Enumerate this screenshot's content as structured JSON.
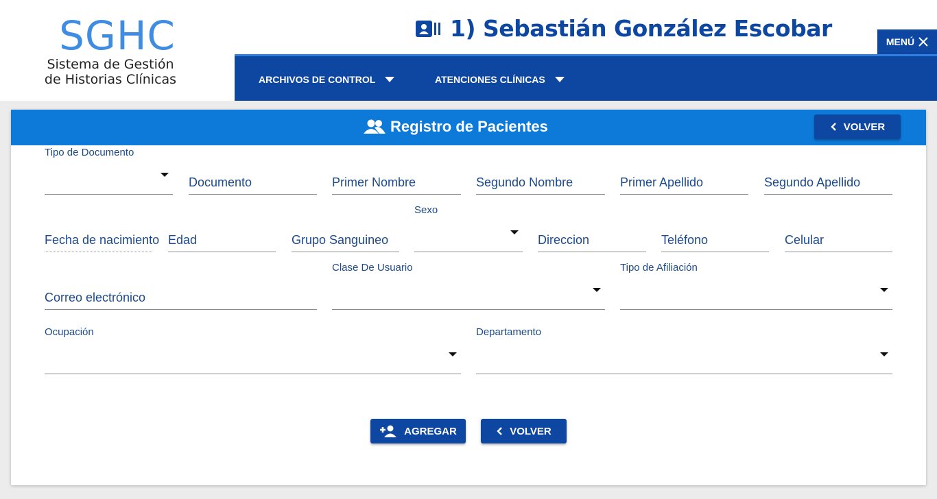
{
  "logo": {
    "title": "SGHC",
    "subtitle_line1": "Sistema de Gestión",
    "subtitle_line2": "de Historias Clínicas"
  },
  "header": {
    "user_title": "1) Sebastián González Escobar",
    "menu_label": "MENÚ"
  },
  "nav": {
    "items": [
      {
        "label": "ARCHIVOS DE CONTROL"
      },
      {
        "label": "ATENCIONES CLÍNICAS"
      }
    ]
  },
  "card": {
    "title": "Registro de Pacientes",
    "back_label": "VOLVER"
  },
  "form": {
    "tipo_documento": "Tipo de Documento",
    "documento": "Documento",
    "primer_nombre": "Primer Nombre",
    "segundo_nombre": "Segundo Nombre",
    "primer_apellido": "Primer Apellido",
    "segundo_apellido": "Segundo Apellido",
    "fecha_nacimiento": "Fecha de nacimiento",
    "edad": "Edad",
    "grupo_sanguineo": "Grupo Sanguineo",
    "sexo": "Sexo",
    "direccion": "Direccion",
    "telefono": "Teléfono",
    "celular": "Celular",
    "correo": "Correo electrónico",
    "clase_usuario": "Clase De Usuario",
    "tipo_afiliacion": "Tipo de Afiliación",
    "ocupacion": "Ocupación",
    "departamento": "Departamento"
  },
  "actions": {
    "add_label": "AGREGAR",
    "back_label": "VOLVER"
  },
  "colors": {
    "primary": "#0d47a1",
    "header_blue": "#0d7ad9",
    "logo_blue": "#3f8de3"
  }
}
